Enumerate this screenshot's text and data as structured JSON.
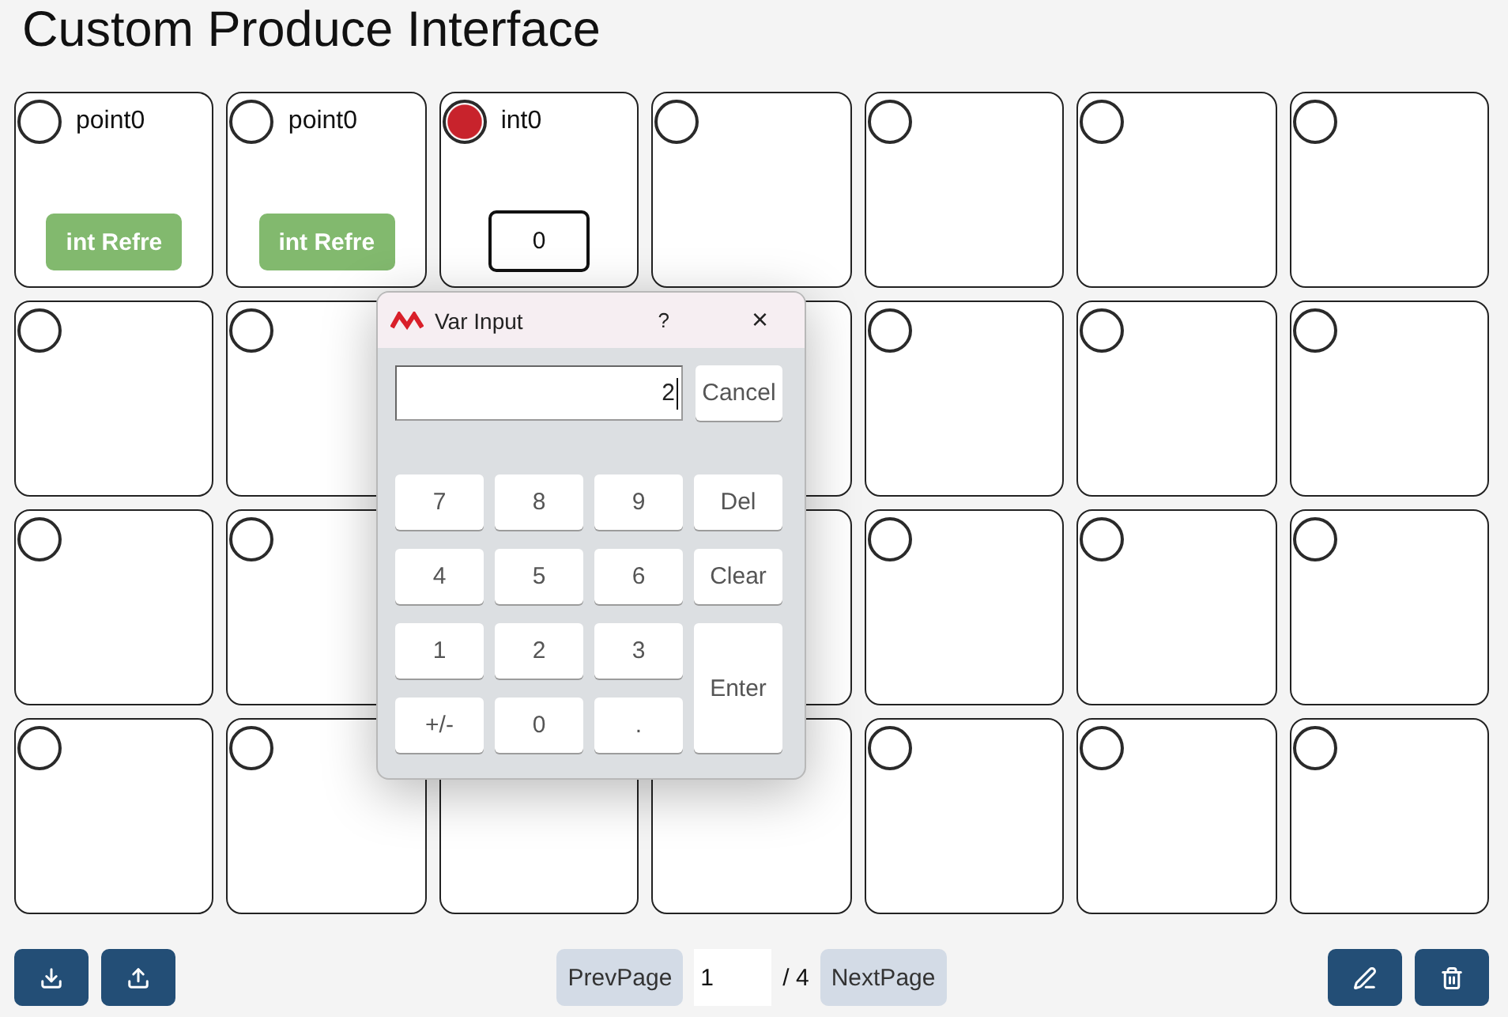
{
  "title": "Custom Produce Interface",
  "cards": [
    {
      "kind": "point",
      "label": "point0",
      "active": false,
      "button": "int Refre"
    },
    {
      "kind": "point",
      "label": "point0",
      "active": false,
      "button": "int Refre"
    },
    {
      "kind": "int",
      "label": "int0",
      "active": true,
      "value": "0"
    },
    {
      "kind": "empty",
      "active": false
    },
    {
      "kind": "empty",
      "active": false
    },
    {
      "kind": "empty",
      "active": false
    },
    {
      "kind": "empty",
      "active": false
    },
    {
      "kind": "empty",
      "active": false
    },
    {
      "kind": "empty",
      "active": false
    },
    {
      "kind": "hidden"
    },
    {
      "kind": "blank"
    },
    {
      "kind": "empty",
      "active": false
    },
    {
      "kind": "empty",
      "active": false
    },
    {
      "kind": "empty",
      "active": false
    },
    {
      "kind": "empty",
      "active": false
    },
    {
      "kind": "empty",
      "active": false
    },
    {
      "kind": "hidden"
    },
    {
      "kind": "blank"
    },
    {
      "kind": "empty",
      "active": false
    },
    {
      "kind": "empty",
      "active": false
    },
    {
      "kind": "empty",
      "active": false
    },
    {
      "kind": "empty",
      "active": false
    },
    {
      "kind": "empty",
      "active": false
    },
    {
      "kind": "blank"
    },
    {
      "kind": "blank"
    },
    {
      "kind": "empty",
      "active": false
    },
    {
      "kind": "empty",
      "active": false
    },
    {
      "kind": "empty",
      "active": false
    }
  ],
  "dialog": {
    "title": "Var Input",
    "help": "?",
    "close": "×",
    "value": "2",
    "cancel": "Cancel",
    "keys": [
      {
        "label": "7",
        "kind": "key"
      },
      {
        "label": "8",
        "kind": "key"
      },
      {
        "label": "9",
        "kind": "key"
      },
      {
        "label": "Del",
        "kind": "key"
      },
      {
        "label": "4",
        "kind": "key"
      },
      {
        "label": "5",
        "kind": "key"
      },
      {
        "label": "6",
        "kind": "key"
      },
      {
        "label": "Clear",
        "kind": "key"
      },
      {
        "label": "1",
        "kind": "key"
      },
      {
        "label": "2",
        "kind": "key"
      },
      {
        "label": "3",
        "kind": "key"
      },
      {
        "label": "Enter",
        "kind": "enter"
      },
      {
        "label": "+/-",
        "kind": "key"
      },
      {
        "label": "0",
        "kind": "key"
      },
      {
        "label": ".",
        "kind": "key"
      }
    ]
  },
  "toolbar": {
    "left": [
      {
        "kind": "download"
      },
      {
        "kind": "upload"
      }
    ],
    "right": [
      {
        "kind": "edit"
      },
      {
        "kind": "delete"
      }
    ]
  },
  "pagination": {
    "prev": "PrevPage",
    "page": "1",
    "total": "/ 4",
    "next": "NextPage"
  }
}
